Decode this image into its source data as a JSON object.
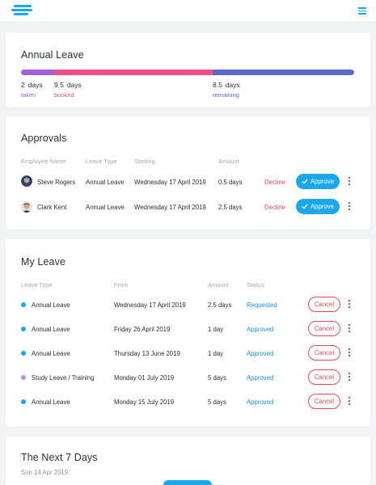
{
  "colors": {
    "accent": "#1aa7ec",
    "danger": "#e0495a",
    "taken": "#a35fe0",
    "booked": "#ef4f87",
    "remaining": "#5c6bc8",
    "requested": "#1a8fd6",
    "approved": "#1a8fd6"
  },
  "icons": {
    "logo": "company-logo-icon",
    "menu": "hamburger-menu-icon",
    "approve": "check-icon",
    "more": "kebab-menu-icon"
  },
  "annual_leave": {
    "title": "Annual Leave",
    "stats": [
      {
        "value": "2",
        "unit": "days",
        "label": "taken",
        "amount": 2,
        "color": "#a35fe0"
      },
      {
        "value": "9.5",
        "unit": "days",
        "label": "booked",
        "amount": 9.5,
        "color": "#ef4f87"
      },
      {
        "value": "8.5",
        "unit": "days",
        "label": "remaining",
        "amount": 8.5,
        "color": "#5c6bc8"
      }
    ]
  },
  "approvals": {
    "title": "Approvals",
    "headers": {
      "employee": "Employee Name",
      "type": "Leave Type",
      "starting": "Starting",
      "amount": "Amount"
    },
    "decline_label": "Decline",
    "approve_label": "Approve",
    "rows": [
      {
        "name": "Steve Rogers",
        "type": "Annual Leave",
        "starting": "Wednesday 17 April 2019",
        "amount": "0.5 days"
      },
      {
        "name": "Clark Kent",
        "type": "Annual Leave",
        "starting": "Wednesday 17 April 2019",
        "amount": "2.5 days"
      }
    ]
  },
  "my_leave": {
    "title": "My Leave",
    "headers": {
      "type": "Leave Type",
      "from": "From",
      "amount": "Amount",
      "status": "Status"
    },
    "cancel_label": "Cancel",
    "rows": [
      {
        "type": "Annual Leave",
        "from": "Wednesday 17 April 2019",
        "amount": "2.5 days",
        "status": "Requested",
        "dot": "#1aa7ec"
      },
      {
        "type": "Annual Leave",
        "from": "Friday 26 April 2019",
        "amount": "1 day",
        "status": "Approved",
        "dot": "#1aa7ec"
      },
      {
        "type": "Annual Leave",
        "from": "Thursday 13 June 2019",
        "amount": "1 day",
        "status": "Approved",
        "dot": "#1aa7ec"
      },
      {
        "type": "Study Leave / Training",
        "from": "Monday 01 July 2019",
        "amount": "5 days",
        "status": "Approved",
        "dot": "#b98ee0"
      },
      {
        "type": "Annual Leave",
        "from": "Monday 15 July 2019",
        "amount": "5 days",
        "status": "Approved",
        "dot": "#1aa7ec"
      }
    ]
  },
  "next_7_days": {
    "title": "The Next 7 Days",
    "date": "Sun 14 Apr 2019"
  }
}
